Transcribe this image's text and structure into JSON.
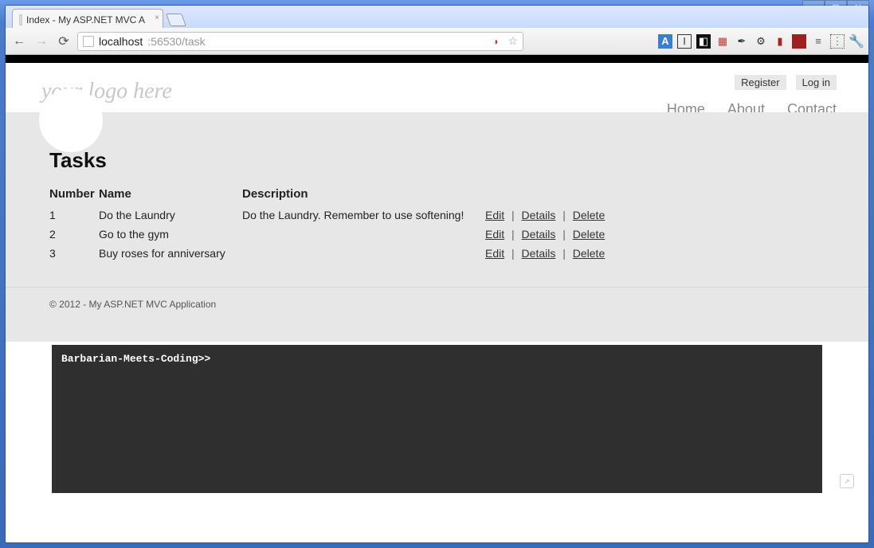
{
  "window": {
    "tab_title": "Index - My ASP.NET MVC A",
    "url_host": "localhost",
    "url_port_path": ":56530/task"
  },
  "toolbar_icons": {
    "back": "←",
    "forward": "→",
    "reload": "⟳",
    "star": "☆",
    "minimize": "—",
    "maximize": "▢",
    "close": "✕"
  },
  "header": {
    "logo_text": "your logo here",
    "register": "Register",
    "login": "Log in",
    "nav": {
      "home": "Home",
      "about": "About",
      "contact": "Contact"
    }
  },
  "content": {
    "title": "Tasks",
    "columns": {
      "number": "Number",
      "name": "Name",
      "description": "Description"
    },
    "rows": [
      {
        "number": "1",
        "name": "Do the Laundry",
        "description": "Do the Laundry. Remember to use softening!"
      },
      {
        "number": "2",
        "name": "Go to the gym",
        "description": ""
      },
      {
        "number": "3",
        "name": "Buy roses for anniversary",
        "description": ""
      }
    ],
    "actions": {
      "edit": "Edit",
      "details": "Details",
      "delete": "Delete",
      "separator": "|"
    }
  },
  "footer": {
    "copyright": "© 2012 - My ASP.NET MVC Application"
  },
  "terminal": {
    "prompt": "Barbarian-Meets-Coding>>"
  }
}
